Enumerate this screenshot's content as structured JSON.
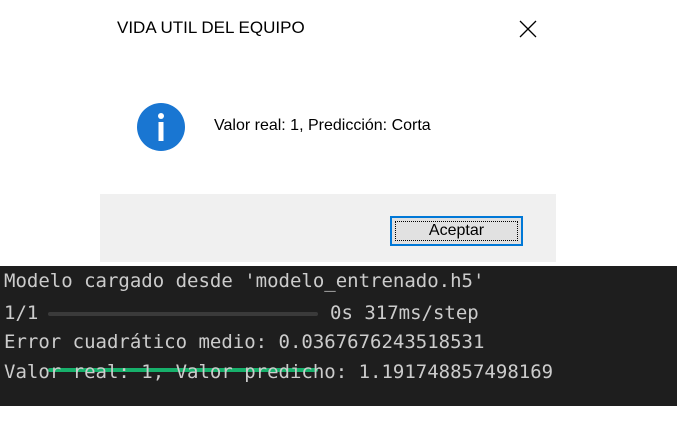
{
  "dialog": {
    "title": "VIDA UTIL DEL EQUIPO",
    "message": "Valor real: 1, Predicción: Corta",
    "ok_label": "Aceptar",
    "icon": "info-icon",
    "accent_color": "#1976d2"
  },
  "terminal": {
    "lines": [
      "Modelo cargado desde 'modelo_entrenado.h5'",
      "Error cuadrático medio: 0.0367676243518531",
      "Valor real: 1, Valor predicho: 1.191748857498169"
    ],
    "progress": {
      "step": "1/1",
      "fraction": 1.0,
      "timing": "0s 317ms/step",
      "color": "#17b06b"
    }
  }
}
